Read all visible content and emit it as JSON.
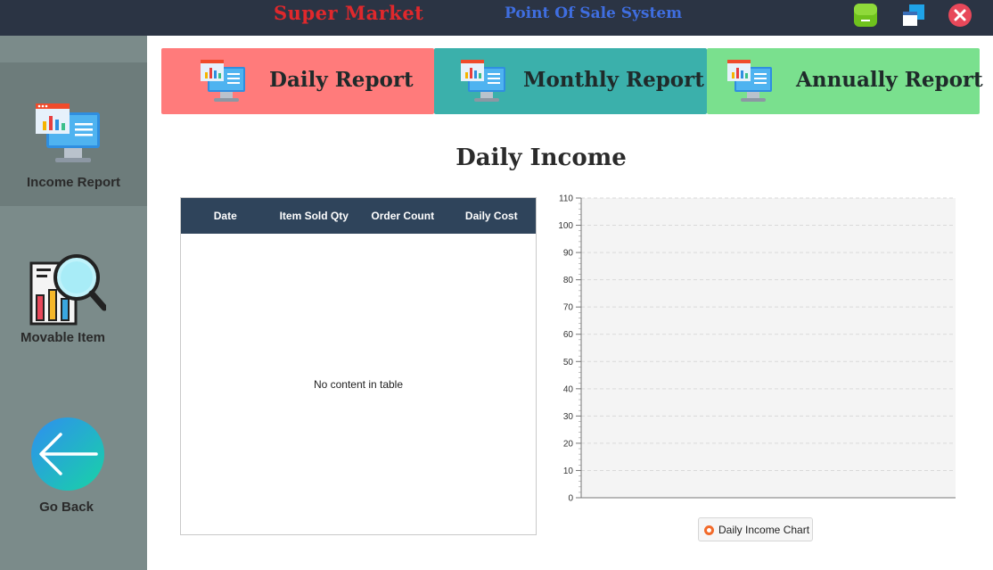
{
  "titlebar": {
    "brand": "Super Market",
    "subtitle": "Point Of Sale System",
    "minimize_icon": "minimize-icon",
    "maximize_icon": "restore-icon",
    "close_icon": "close-icon"
  },
  "sidebar": {
    "items": [
      {
        "label": "Income Report",
        "icon": "income-report-icon",
        "active": true
      },
      {
        "label": "Movable Item",
        "icon": "movable-item-icon",
        "active": false
      },
      {
        "label": "Go Back",
        "icon": "back-arrow-icon",
        "active": false
      }
    ]
  },
  "report_tabs": [
    {
      "label": "Daily Report",
      "color": "#ff7b7b"
    },
    {
      "label": "Monthly Report",
      "color": "#3bb0ab"
    },
    {
      "label": "Annually Report",
      "color": "#7ae08e"
    }
  ],
  "section_title": "Daily Income",
  "table": {
    "columns": [
      "Date",
      "Item Sold Qty",
      "Order Count",
      "Daily Cost"
    ],
    "rows": [],
    "placeholder": "No content in table"
  },
  "chart_data": {
    "type": "line",
    "title": "",
    "xlabel": "",
    "ylabel": "",
    "ylim": [
      0,
      110
    ],
    "y_ticks": [
      0,
      10,
      20,
      30,
      40,
      50,
      60,
      70,
      80,
      90,
      100,
      110
    ],
    "grid": true,
    "series": [
      {
        "name": "Daily Income Chart",
        "values": [],
        "color": "#f26a2a"
      }
    ],
    "legend_position": "bottom"
  }
}
